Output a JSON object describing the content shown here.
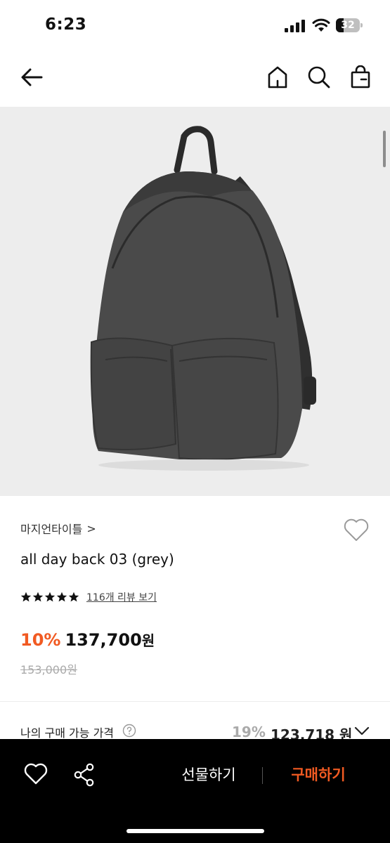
{
  "status_bar": {
    "time": "6:23",
    "battery_level": "32"
  },
  "nav": {
    "back_icon": "arrow-left-icon",
    "home_icon": "home-icon",
    "search_icon": "search-icon",
    "cart_icon": "shopping-bag-icon"
  },
  "product": {
    "image_alt": "grey backpack",
    "brand": "마지언타이틀",
    "brand_chevron": ">",
    "name": "all day back 03 (grey)",
    "rating_stars": 5,
    "review_link": "116개 리뷰 보기",
    "discount": "10%",
    "price": "137,700",
    "price_unit": "원",
    "original_price": "153,000원"
  },
  "benefit": {
    "label": "나의 구매 가능 가격",
    "rate": "19%",
    "price": "123,718 원"
  },
  "bottom_bar": {
    "gift_label": "선물하기",
    "buy_label": "구매하기"
  },
  "colors": {
    "accent": "#f15a22",
    "bottom_bar_bg": "#000000",
    "image_bg": "#ededed"
  }
}
